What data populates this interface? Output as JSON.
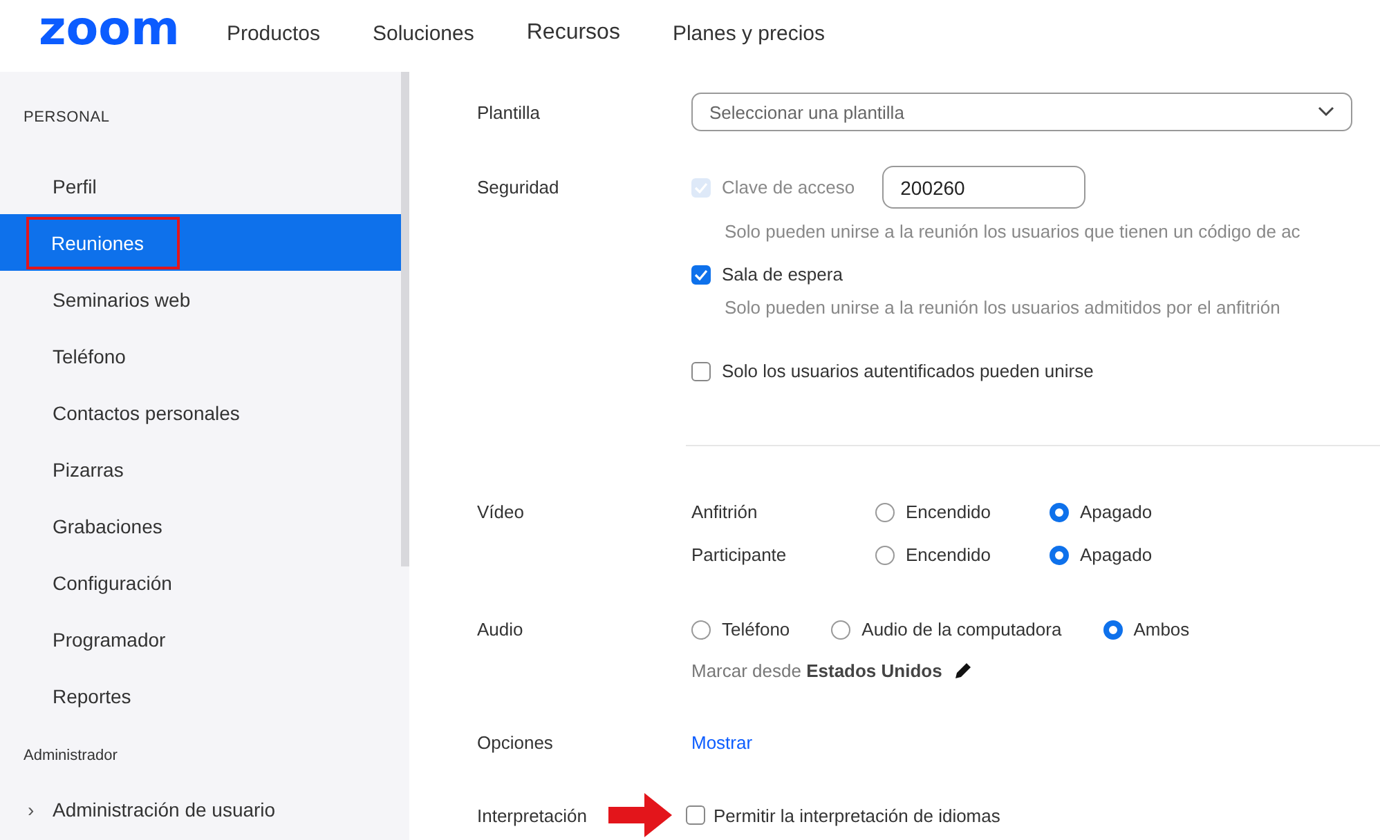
{
  "header": {
    "logo": "zoom",
    "nav": [
      "Productos",
      "Soluciones",
      "Recursos",
      "Planes y precios"
    ]
  },
  "sidebar": {
    "sections": [
      {
        "title": "PERSONAL",
        "kind": "caps",
        "items": [
          {
            "label": "Perfil",
            "selected": false,
            "highlighted": false
          },
          {
            "label": "Reuniones",
            "selected": true,
            "highlighted": true
          },
          {
            "label": "Seminarios web",
            "selected": false,
            "highlighted": false
          },
          {
            "label": "Teléfono",
            "selected": false,
            "highlighted": false
          },
          {
            "label": "Contactos personales",
            "selected": false,
            "highlighted": false
          },
          {
            "label": "Pizarras",
            "selected": false,
            "highlighted": false
          },
          {
            "label": "Grabaciones",
            "selected": false,
            "highlighted": false
          },
          {
            "label": "Configuración",
            "selected": false,
            "highlighted": false
          },
          {
            "label": "Programador",
            "selected": false,
            "highlighted": false
          },
          {
            "label": "Reportes",
            "selected": false,
            "highlighted": false
          }
        ]
      },
      {
        "title": "Administrador",
        "kind": "plain",
        "items": [
          {
            "label": "Administración de usuario",
            "selected": false,
            "highlighted": false,
            "chevron": "›"
          }
        ]
      }
    ]
  },
  "template": {
    "label": "Plantilla",
    "placeholder": "Seleccionar una plantilla"
  },
  "security": {
    "label": "Seguridad",
    "passcode": {
      "label": "Clave de acceso",
      "checked": true,
      "disabled": true,
      "value": "200260",
      "description": "Solo pueden unirse a la reunión los usuarios que tienen un código de ac"
    },
    "options": [
      {
        "label": "Sala de espera",
        "checked": true,
        "description": "Solo pueden unirse a la reunión los usuarios admitidos por el anfitrión"
      },
      {
        "label": "Solo los usuarios autentificados pueden unirse",
        "checked": false
      }
    ]
  },
  "video": {
    "label": "Vídeo",
    "rows": [
      {
        "label": "Anfitrión",
        "options": [
          {
            "label": "Encendido",
            "selected": false
          },
          {
            "label": "Apagado",
            "selected": true
          }
        ]
      },
      {
        "label": "Participante",
        "options": [
          {
            "label": "Encendido",
            "selected": false
          },
          {
            "label": "Apagado",
            "selected": true
          }
        ]
      }
    ]
  },
  "audio": {
    "label": "Audio",
    "options": [
      {
        "label": "Teléfono",
        "selected": false
      },
      {
        "label": "Audio de la computadora",
        "selected": false
      },
      {
        "label": "Ambos",
        "selected": true
      }
    ],
    "dial_in": "Marcar desde **Estados Unidos**"
  },
  "options_row": {
    "label": "Opciones",
    "link": "Mostrar"
  },
  "interpretation": {
    "label": "Interpretación",
    "arrow": true,
    "option": {
      "label": "Permitir la interpretación de idiomas",
      "checked": false
    }
  }
}
